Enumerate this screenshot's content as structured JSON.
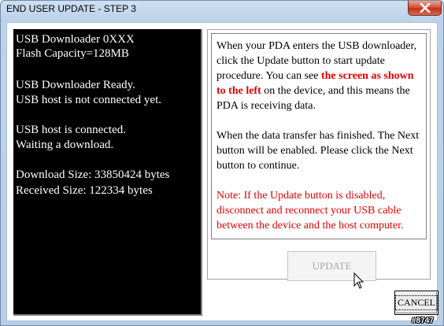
{
  "window": {
    "title": "END USER UPDATE - STEP 3"
  },
  "titlebar": {
    "close_icon": "close-x-icon"
  },
  "console": {
    "lines": [
      "USB Downloader 0XXX",
      "Flash Capacity=128MB",
      "USB Downloader Ready.",
      "USB host is not connected yet.",
      "USB host is connected.",
      "Waiting a download.",
      "Download Size: 33850424 bytes",
      "Received Size: 122334 bytes"
    ]
  },
  "instructions": {
    "p1_a": "When your PDA enters the USB downloader, click the Update button to start update procedure. You can see ",
    "p1_highlight": "the screen as shown to the left",
    "p1_b": " on the device, and this means the PDA is receiving data.",
    "p2": "When the data transfer has finished. The Next button will be enabled. Please click the Next button to continue.",
    "p3": "Note: If the Update button is disabled, disconnect and reconnect your USB cable between the device and the host computer."
  },
  "buttons": {
    "update_label": "UPDATE",
    "update_enabled": false,
    "cancel_label": "CANCEL"
  },
  "watermark": "#8747",
  "colors": {
    "console_bg": "#000000",
    "console_text": "#ffffff",
    "highlight_red": "#e00000",
    "frame_blue": "#bdd3ea",
    "close_red": "#c1311a"
  },
  "icons": {
    "cursor": "mouse-pointer-icon"
  }
}
